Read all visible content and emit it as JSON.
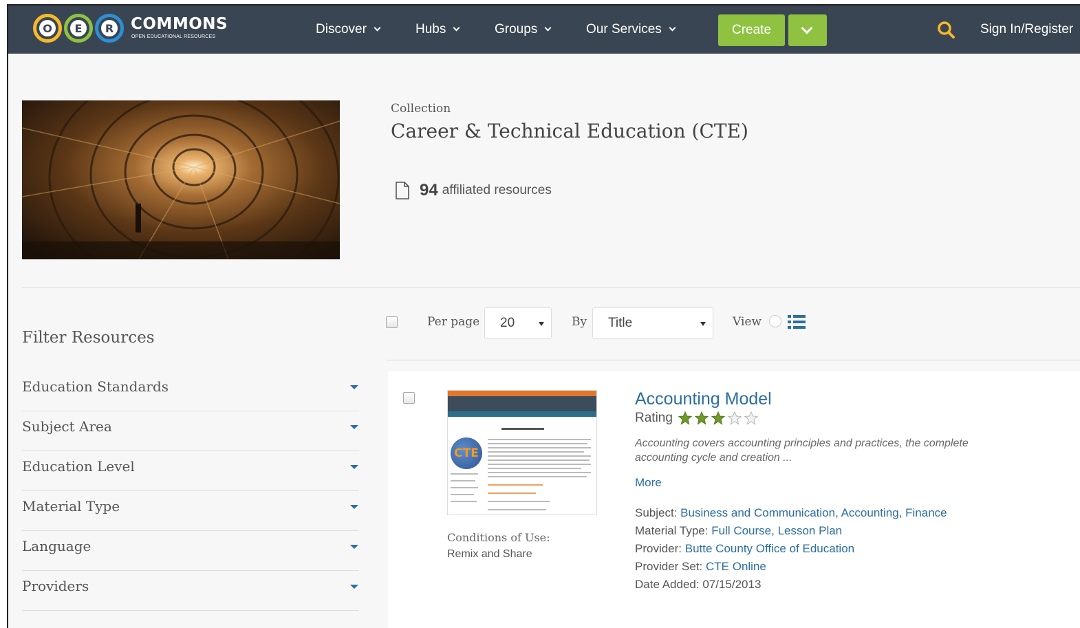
{
  "header": {
    "logo_letters": [
      "O",
      "E",
      "R"
    ],
    "logo_colors": [
      "#f7b928",
      "#8fc241",
      "#2d8fd5"
    ],
    "logo_name": "COMMONS",
    "logo_subtitle": "OPEN EDUCATIONAL RESOURCES",
    "nav": [
      "Discover",
      "Hubs",
      "Groups",
      "Our Services"
    ],
    "create_label": "Create",
    "signin_label": "Sign In/Register",
    "bar_color": "#3a4553",
    "accent_green": "#8fc241",
    "search_icon_color": "#f7b928"
  },
  "collection": {
    "label": "Collection",
    "title": "Career & Technical Education (CTE)",
    "count": "94",
    "count_label": "affiliated resources"
  },
  "filters": {
    "title": "Filter Resources",
    "items": [
      "Education Standards",
      "Subject Area",
      "Education Level",
      "Material Type",
      "Language",
      "Providers"
    ]
  },
  "toolbar": {
    "per_page_label": "Per page",
    "per_page_value": "20",
    "by_label": "By",
    "by_value": "Title",
    "view_label": "View"
  },
  "result": {
    "title": "Accounting Model",
    "rating_label": "Rating",
    "rating": 3,
    "rating_max": 5,
    "description": "Accounting covers accounting principles and practices, the complete accounting cycle and creation ...",
    "more_label": "More",
    "thumb_badge": "CTE",
    "conditions_label": "Conditions of Use:",
    "conditions_value": "Remix and Share",
    "meta": {
      "subject_label": "Subject:",
      "subject_value": "Business and Communication, Accounting, Finance",
      "material_label": "Material Type:",
      "material_value": "Full Course, Lesson Plan",
      "provider_label": "Provider:",
      "provider_value": "Butte County Office of Education",
      "provider_set_label": "Provider Set:",
      "provider_set_value": "CTE Online",
      "date_label": "Date Added:",
      "date_value": "07/15/2013"
    }
  }
}
